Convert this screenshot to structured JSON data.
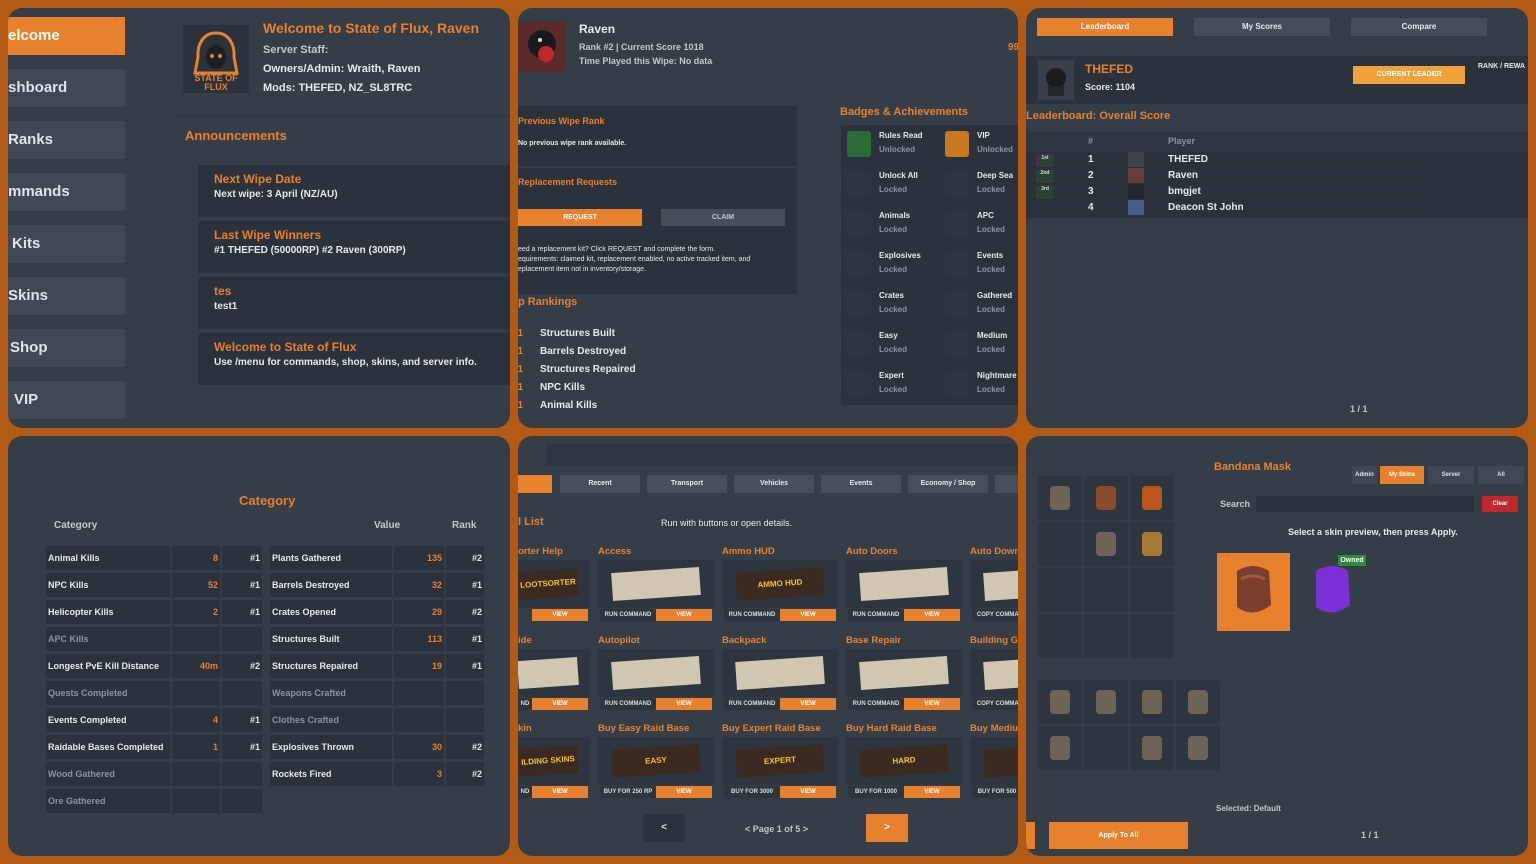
{
  "p1": {
    "nav": [
      "elcome",
      "shboard",
      "Ranks",
      "mmands",
      "Kits",
      "Skins",
      "Shop",
      "VIP"
    ],
    "logo_text": "STATE OF FLUX",
    "welcome_title": "Welcome to State of Flux, Raven",
    "staff_label": "Server Staff:",
    "owners": "Owners/Admin: Wraith, Raven",
    "mods": "Mods: THEFED, NZ_SL8TRC",
    "announcements_title": "Announcements",
    "announcements": [
      {
        "title": "Next Wipe Date",
        "desc": "Next wipe: 3 April (NZ/AU)"
      },
      {
        "title": "Last Wipe Winners",
        "desc": "#1 THEFED (50000RP)  #2 Raven (300RP)"
      },
      {
        "title": "tes",
        "desc": "test1"
      },
      {
        "title": "Welcome to State of Flux",
        "desc": "Use /menu for commands, shop, skins, and server info."
      }
    ]
  },
  "p2": {
    "player_name": "Raven",
    "rank_line": "Rank #2  |  Current Score 1018",
    "time_line": "Time Played this Wipe: No data",
    "edge_num": "99",
    "prev_wipe_title": "Previous Wipe Rank",
    "prev_wipe_desc": "No previous wipe rank available.",
    "replacement_title": "Replacement Requests",
    "request_btn": "REQUEST",
    "claim_btn": "CLAIM",
    "replacement_desc_1": "eed a replacement kit? Click REQUEST and complete the form.",
    "replacement_desc_2": "equirements: claimed kit, replacement enabled, no active tracked item, and",
    "replacement_desc_3": "eplacement item not in inventory/storage.",
    "rankings_title": "p Rankings",
    "rankings": [
      {
        "rank": "#1",
        "name": "Structures Built"
      },
      {
        "rank": "#1",
        "name": "Barrels Destroyed"
      },
      {
        "rank": "#1",
        "name": "Structures Repaired"
      },
      {
        "rank": "#1",
        "name": "NPC Kills"
      },
      {
        "rank": "#1",
        "name": "Animal Kills"
      }
    ],
    "badges_title": "Badges & Achievements",
    "badges": [
      {
        "name": "Rules Read",
        "status": "Unlocked"
      },
      {
        "name": "VIP",
        "status": "Unlocked"
      },
      {
        "name": "Unlock All",
        "status": "Locked"
      },
      {
        "name": "Deep Sea",
        "status": "Locked"
      },
      {
        "name": "Animals",
        "status": "Locked"
      },
      {
        "name": "APC",
        "status": "Locked"
      },
      {
        "name": "Explosives",
        "status": "Locked"
      },
      {
        "name": "Events",
        "status": "Locked"
      },
      {
        "name": "Crates",
        "status": "Locked"
      },
      {
        "name": "Gathered",
        "status": "Locked"
      },
      {
        "name": "Easy",
        "status": "Locked"
      },
      {
        "name": "Medium",
        "status": "Locked"
      },
      {
        "name": "Expert",
        "status": "Locked"
      },
      {
        "name": "Nightmare",
        "status": "Locked"
      }
    ]
  },
  "p3": {
    "tabs": [
      "Leaderboard",
      "My Scores",
      "Compare"
    ],
    "leader_name": "THEFED",
    "leader_score": "Score: 1104",
    "leader_btn": "CURRENT LEADER",
    "rank_reward": "RANK / REWA",
    "board_title": "Leaderboard: Overall Score",
    "col_rank": "#",
    "col_player": "Player",
    "rows": [
      {
        "rank": "1",
        "player": "THEFED"
      },
      {
        "rank": "2",
        "player": "Raven"
      },
      {
        "rank": "3",
        "player": "bmgjet"
      },
      {
        "rank": "4",
        "player": "Deacon St John"
      }
    ],
    "medals": [
      "1st",
      "2nd",
      "3rd"
    ],
    "pager": "1 / 1"
  },
  "p4": {
    "title": "Category",
    "col_category": "Category",
    "col_value": "Value",
    "col_rank": "Rank",
    "left": [
      {
        "name": "Animal Kills",
        "value": "8",
        "rank": "#1"
      },
      {
        "name": "NPC Kills",
        "value": "52",
        "rank": "#1"
      },
      {
        "name": "Helicopter Kills",
        "value": "2",
        "rank": "#1"
      },
      {
        "name": "APC Kills",
        "value": "",
        "rank": ""
      },
      {
        "name": "Longest PvE Kill Distance",
        "value": "40m",
        "rank": "#2"
      },
      {
        "name": "Quests Completed",
        "value": "",
        "rank": ""
      },
      {
        "name": "Events Completed",
        "value": "4",
        "rank": "#1"
      },
      {
        "name": "Raidable Bases Completed",
        "value": "1",
        "rank": "#1"
      },
      {
        "name": "Wood Gathered",
        "value": "",
        "rank": ""
      },
      {
        "name": "Ore Gathered",
        "value": "",
        "rank": ""
      }
    ],
    "right": [
      {
        "name": "Plants Gathered",
        "value": "135",
        "rank": "#2"
      },
      {
        "name": "Barrels Destroyed",
        "value": "32",
        "rank": "#1"
      },
      {
        "name": "Crates Opened",
        "value": "29",
        "rank": "#2"
      },
      {
        "name": "Structures Built",
        "value": "113",
        "rank": "#1"
      },
      {
        "name": "Structures Repaired",
        "value": "19",
        "rank": "#1"
      },
      {
        "name": "Weapons Crafted",
        "value": "",
        "rank": ""
      },
      {
        "name": "Clothes Crafted",
        "value": "",
        "rank": ""
      },
      {
        "name": "Explosives Thrown",
        "value": "30",
        "rank": "#2"
      },
      {
        "name": "Rockets Fired",
        "value": "3",
        "rank": "#2"
      }
    ]
  },
  "p5": {
    "tabs": [
      "Recent",
      "Transport",
      "Vehicles",
      "Events",
      "Economy / Shop"
    ],
    "list_title": "l List",
    "hint": "Run with buttons or open details.",
    "cards": [
      {
        "title": "orter Help",
        "b1": "",
        "b2": "VIEW",
        "art": "LOOTSORTER"
      },
      {
        "title": "Access",
        "b1": "RUN COMMAND",
        "b2": "VIEW",
        "art": ""
      },
      {
        "title": "Ammo HUD",
        "b1": "RUN COMMAND",
        "b2": "VIEW",
        "art": "AMMO HUD"
      },
      {
        "title": "Auto Doors",
        "b1": "RUN COMMAND",
        "b2": "VIEW",
        "art": ""
      },
      {
        "title": "Auto Downg",
        "b1": "COPY COMMAN",
        "b2": "",
        "art": ""
      },
      {
        "title": "ide",
        "b1": "ND",
        "b2": "VIEW",
        "art": ""
      },
      {
        "title": "Autopilot",
        "b1": "RUN COMMAND",
        "b2": "VIEW",
        "art": ""
      },
      {
        "title": "Backpack",
        "b1": "RUN COMMAND",
        "b2": "VIEW",
        "art": ""
      },
      {
        "title": "Base Repair",
        "b1": "RUN COMMAND",
        "b2": "VIEW",
        "art": ""
      },
      {
        "title": "Building Gra",
        "b1": "COPY COMMAN",
        "b2": "",
        "art": ""
      },
      {
        "title": "kin",
        "b1": "ND",
        "b2": "VIEW",
        "art": "ILDING SKINS"
      },
      {
        "title": "Buy Easy Raid Base",
        "b1": "BUY FOR 250 RP",
        "b2": "VIEW",
        "art": "EASY"
      },
      {
        "title": "Buy Expert Raid Base",
        "b1": "BUY FOR 3000",
        "b2": "VIEW",
        "art": "EXPERT"
      },
      {
        "title": "Buy Hard Raid Base",
        "b1": "BUY FOR 1000",
        "b2": "VIEW",
        "art": "HARD"
      },
      {
        "title": "Buy Medium",
        "b1": "BUY FOR 500 R",
        "b2": "",
        "art": "M"
      }
    ],
    "prev": "<",
    "page": "< Page 1 of 5 >",
    "next": ">"
  },
  "p6": {
    "title": "Bandana Mask",
    "tabs": [
      "Admin",
      "My Skins",
      "Server",
      "All"
    ],
    "search_label": "Search",
    "clear_btn": "Clear",
    "hint": "Select a skin preview, then press Apply.",
    "owned": "Owned",
    "selected": "Selected: Default",
    "apply": "Apply To All",
    "pager": "1 / 1"
  }
}
